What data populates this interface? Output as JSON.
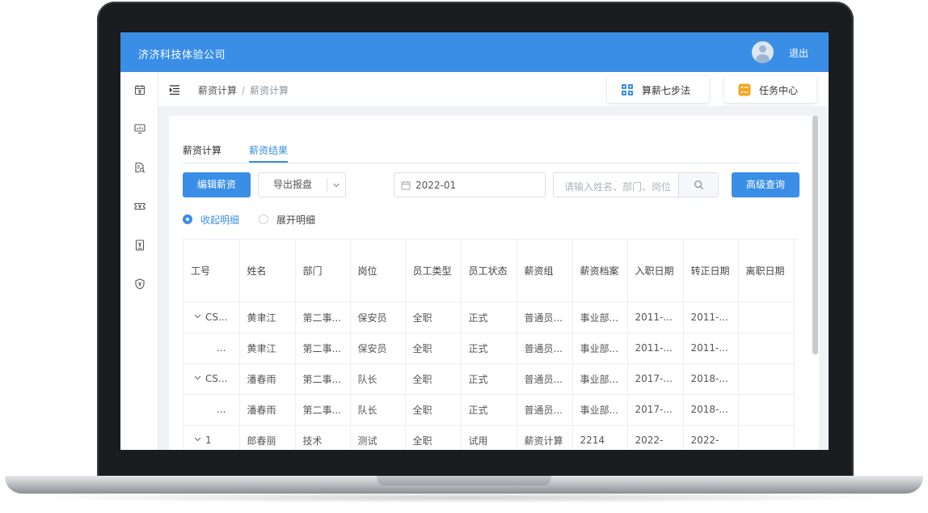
{
  "header": {
    "company": "济济科技体验公司",
    "logout": "退出"
  },
  "sidebar": {
    "icons": [
      "calendar-yen-icon",
      "monitor-chart-icon",
      "document-search-icon",
      "ticket-yen-icon",
      "receipt-yen-icon",
      "shield-yen-icon"
    ]
  },
  "breadcrumb": {
    "parent": "薪资计算",
    "separator": "/",
    "current": "薪资计算"
  },
  "quick_actions": {
    "seven_steps": "算薪七步法",
    "task_center": "任务中心"
  },
  "tabs": [
    {
      "label": "薪资计算"
    },
    {
      "label": "薪资结果"
    }
  ],
  "toolbar": {
    "edit_salary": "编辑薪资",
    "export": "导出报盘",
    "date_value": "2022-01",
    "search_placeholder": "请输入姓名、部门、岗位",
    "advanced_search": "高级查询"
  },
  "view_mode": {
    "collapse": "收起明细",
    "expand": "展开明细",
    "selected": "收起明细"
  },
  "table": {
    "columns": [
      "工号",
      "姓名",
      "部门",
      "岗位",
      "员工类型",
      "员工状态",
      "薪资组",
      "薪资档案",
      "入职日期",
      "转正日期",
      "离职日期"
    ],
    "rows": [
      {
        "expandable": true,
        "cells": [
          "CS...",
          "黄聿江",
          "第二事...",
          "保安员",
          "全职",
          "正式",
          "普通员...",
          "事业部...",
          "2011-...",
          "2011-...",
          ""
        ]
      },
      {
        "expandable": false,
        "cells": [
          "...",
          "黄聿江",
          "第二事...",
          "保安员",
          "全职",
          "正式",
          "普通员...",
          "事业部...",
          "2011-...",
          "2011-...",
          ""
        ]
      },
      {
        "expandable": true,
        "cells": [
          "CS...",
          "潘春雨",
          "第二事...",
          "队长",
          "全职",
          "正式",
          "普通员...",
          "事业部...",
          "2017-...",
          "2018-...",
          ""
        ]
      },
      {
        "expandable": false,
        "cells": [
          "...",
          "潘春雨",
          "第二事...",
          "队长",
          "全职",
          "正式",
          "普通员...",
          "事业部...",
          "2017-...",
          "2018-...",
          ""
        ]
      },
      {
        "expandable": true,
        "cells": [
          "1",
          "郎春丽",
          "技术",
          "测试",
          "全职",
          "试用",
          "薪资计算",
          "2214",
          "2022-",
          "2022-",
          ""
        ]
      }
    ]
  },
  "colors": {
    "primary": "#3a8ee6",
    "header": "#3a8ee6"
  }
}
